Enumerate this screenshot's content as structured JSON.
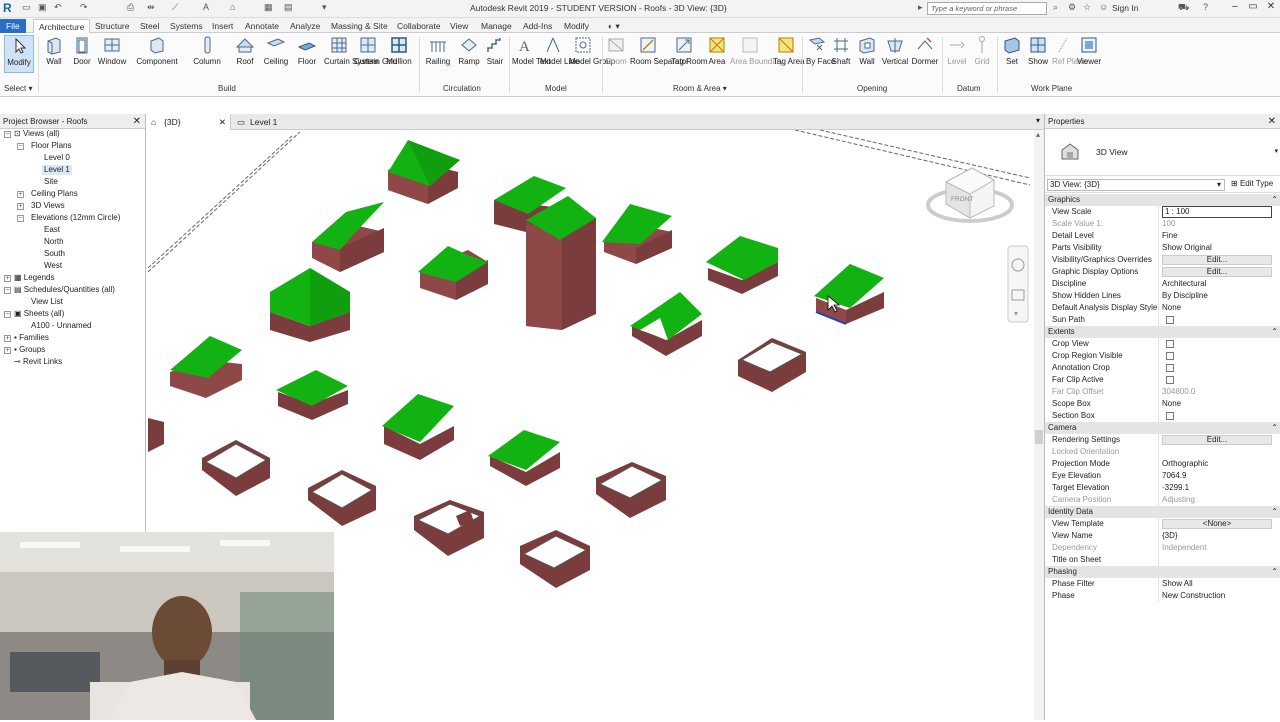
{
  "window": {
    "title": "Autodesk Revit 2019 - STUDENT VERSION - Roofs - 3D View: {3D}",
    "search_placeholder": "Type a keyword or phrase",
    "sign_in": "Sign In"
  },
  "ribbon_tabs": [
    "File",
    "Architecture",
    "Structure",
    "Steel",
    "Systems",
    "Insert",
    "Annotate",
    "Analyze",
    "Massing & Site",
    "Collaborate",
    "View",
    "Manage",
    "Add-Ins",
    "Modify"
  ],
  "active_tab": "Architecture",
  "tools": {
    "modify": "Modify",
    "select": "Select",
    "wall": "Wall",
    "door": "Door",
    "window": "Window",
    "component": "Component",
    "column": "Column",
    "roof": "Roof",
    "ceiling": "Ceiling",
    "floor": "Floor",
    "curtain_system": "Curtain System",
    "curtain_grid": "Curtain Grid",
    "mullion": "Mullion",
    "railing": "Railing",
    "ramp": "Ramp",
    "stair": "Stair",
    "model_text": "Model Text",
    "model_line": "Model Line",
    "model_group": "Model Group",
    "room": "Room",
    "room_separator": "Room Separator",
    "tag_room": "Tag Room",
    "area": "Area",
    "area_boundary": "Area Boundary",
    "tag_area": "Tag Area",
    "by_face": "By Face",
    "shaft": "Shaft",
    "wall_opening": "Wall",
    "vertical": "Vertical",
    "dormer": "Dormer",
    "level": "Level",
    "grid": "Grid",
    "set": "Set",
    "show": "Show",
    "ref_plane": "Ref Plane",
    "viewer": "Viewer"
  },
  "groups": {
    "select": "Select",
    "build": "Build",
    "circulation": "Circulation",
    "model": "Model",
    "room_area": "Room & Area",
    "opening": "Opening",
    "datum": "Datum",
    "work_plane": "Work Plane"
  },
  "project_browser": {
    "title": "Project Browser - Roofs",
    "nodes": {
      "views": "Views (all)",
      "floor_plans": "Floor Plans",
      "level0": "Level 0",
      "level1": "Level 1",
      "site": "Site",
      "ceiling_plans": "Ceiling Plans",
      "views_3d": "3D Views",
      "elevations": "Elevations (12mm Circle)",
      "east": "East",
      "north": "North",
      "south": "South",
      "west": "West",
      "legends": "Legends",
      "schedules": "Schedules/Quantities (all)",
      "view_list": "View List",
      "sheets": "Sheets (all)",
      "a100": "A100 - Unnamed",
      "families": "Families",
      "groups": "Groups",
      "revit_links": "Revit Links"
    }
  },
  "view_tabs": [
    "{3D}",
    "Level 1"
  ],
  "viewcube_label": "FRONT",
  "properties": {
    "title": "Properties",
    "type_name": "3D View",
    "instance_selector": "3D View: {3D}",
    "edit_type": "Edit Type",
    "rows": {
      "graphics": "Graphics",
      "view_scale_k": "View Scale",
      "view_scale_v": "1 : 100",
      "scale_value_k": "Scale Value    1:",
      "scale_value_v": "100",
      "detail_level_k": "Detail Level",
      "detail_level_v": "Fine",
      "parts_vis_k": "Parts Visibility",
      "parts_vis_v": "Show Original",
      "vg_overrides_k": "Visibility/Graphics Overrides",
      "edit": "Edit...",
      "graphic_display_k": "Graphic Display Options",
      "discipline_k": "Discipline",
      "discipline_v": "Architectural",
      "hidden_lines_k": "Show Hidden Lines",
      "hidden_lines_v": "By Discipline",
      "analysis_style_k": "Default Analysis Display Style",
      "analysis_style_v": "None",
      "sun_path_k": "Sun Path",
      "extents": "Extents",
      "crop_view_k": "Crop View",
      "crop_region_k": "Crop Region Visible",
      "annotation_crop_k": "Annotation Crop",
      "far_clip_active_k": "Far Clip Active",
      "far_clip_offset_k": "Far Clip Offset",
      "far_clip_offset_v": "304800.0",
      "scope_box_k": "Scope Box",
      "scope_box_v": "None",
      "section_box_k": "Section Box",
      "camera": "Camera",
      "rendering_k": "Rendering Settings",
      "locked_orient_k": "Locked Orientation",
      "projection_k": "Projection Mode",
      "projection_v": "Orthographic",
      "eye_elev_k": "Eye Elevation",
      "eye_elev_v": "7064.9",
      "target_elev_k": "Target Elevation",
      "target_elev_v": "-3299.1",
      "camera_pos_k": "Camera Position",
      "camera_pos_v": "Adjusting",
      "identity": "Identity Data",
      "view_template_k": "View Template",
      "view_template_v": "<None>",
      "view_name_k": "View Name",
      "view_name_v": "{3D}",
      "dependency_k": "Dependency",
      "dependency_v": "Independent",
      "title_sheet_k": "Title on Sheet",
      "phasing": "Phasing",
      "phase_filter_k": "Phase Filter",
      "phase_filter_v": "Show All",
      "phase_k": "Phase",
      "phase_v": "New Construction"
    }
  },
  "colors": {
    "roof": "#11b211",
    "roof_dark": "#0a8a0a",
    "wall": "#7a3c3c",
    "wall_light": "#9b5454",
    "accent": "#2a6dc4"
  }
}
